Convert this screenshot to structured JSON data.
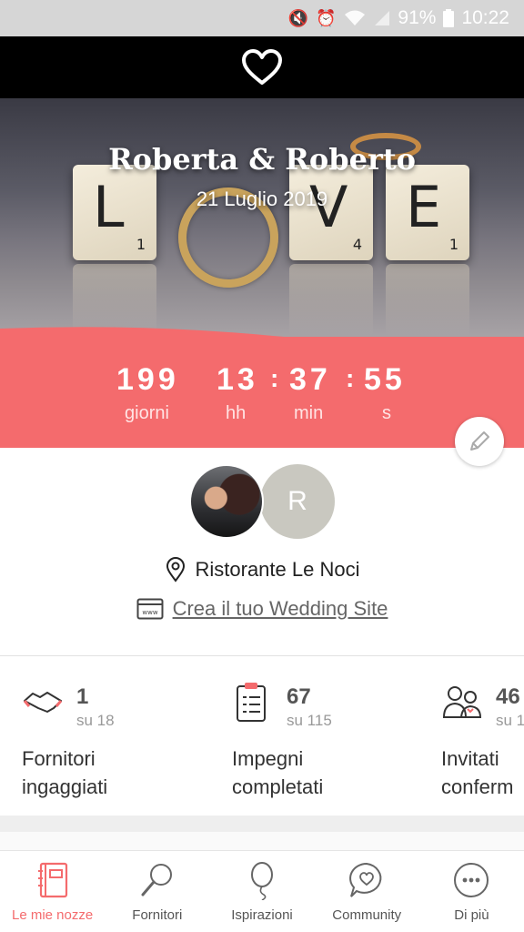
{
  "status_bar": {
    "battery": "91%",
    "time": "10:22"
  },
  "hero": {
    "couple_names": "Roberta & Roberto",
    "date": "21 Luglio 2019",
    "tiles": [
      {
        "letter": "L",
        "score": "1"
      },
      {
        "letter": "V",
        "score": "4"
      },
      {
        "letter": "E",
        "score": "1"
      }
    ]
  },
  "countdown": {
    "days": "199",
    "hours": "13",
    "minutes": "37",
    "seconds": "55",
    "sep": ":",
    "labels": {
      "days": "giorni",
      "hours": "hh",
      "minutes": "min",
      "seconds": "s"
    }
  },
  "couple": {
    "second_avatar_initial": "R",
    "venue": "Ristorante Le Noci",
    "website_link": "Crea il tuo Wedding Site"
  },
  "stats": [
    {
      "value": "1",
      "of": "su 18",
      "label_line1": "Fornitori",
      "label_line2": "ingaggiati"
    },
    {
      "value": "67",
      "of": "su 115",
      "label_line1": "Impegni",
      "label_line2": "completati"
    },
    {
      "value": "46",
      "of": "su 1",
      "label_line1": "Invitati",
      "label_line2": "conferm"
    }
  ],
  "bottom_nav": [
    {
      "label": "Le mie nozze",
      "icon": "notebook-icon",
      "active": true
    },
    {
      "label": "Fornitori",
      "icon": "search-icon",
      "active": false
    },
    {
      "label": "Ispirazioni",
      "icon": "balloon-icon",
      "active": false
    },
    {
      "label": "Community",
      "icon": "chat-heart-icon",
      "active": false
    },
    {
      "label": "Di più",
      "icon": "more-icon",
      "active": false
    }
  ],
  "colors": {
    "accent": "#f46b6d",
    "header": "#000000",
    "avatar_gray": "#c9c8c0"
  }
}
